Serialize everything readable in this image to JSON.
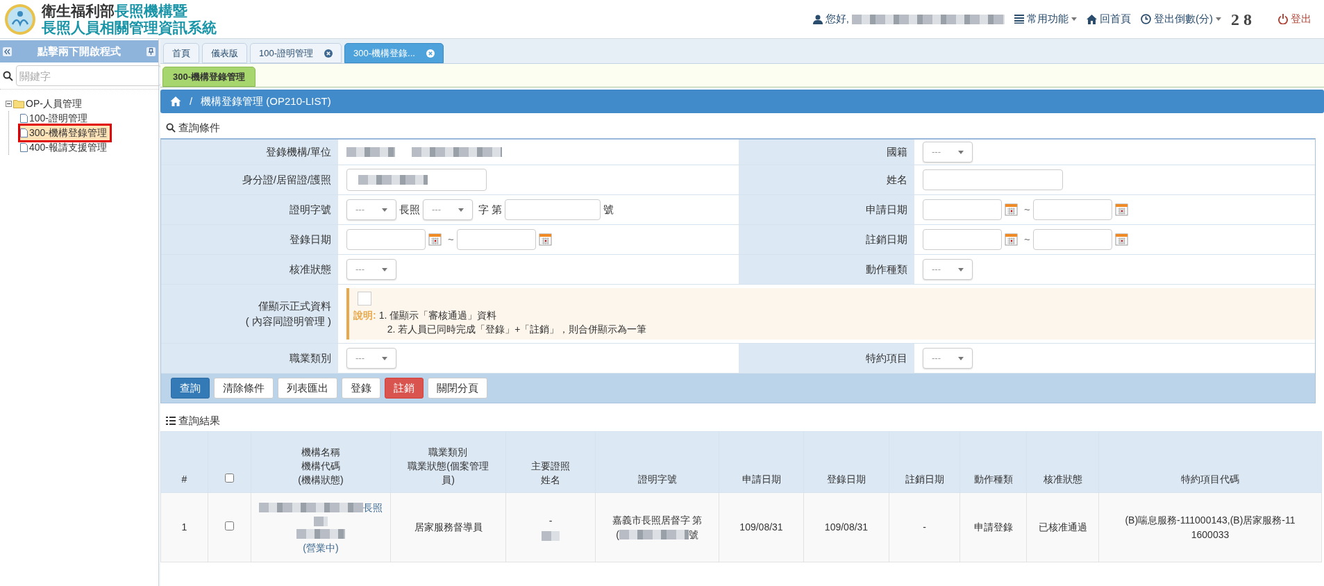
{
  "header": {
    "title_org": "衛生福利部",
    "title_system_line_1": "長照機構暨",
    "title_system_line_2": "長照人員相關管理資訊系統",
    "nav": [
      {
        "kind": "greeting",
        "label": "您好,"
      },
      {
        "kind": "menu",
        "label": "常用功能"
      },
      {
        "kind": "home",
        "label": "回首頁"
      },
      {
        "kind": "timer",
        "label": "登出倒數(分)"
      },
      {
        "kind": "countdown",
        "label": "2 8"
      },
      {
        "kind": "logout",
        "label": "登出"
      }
    ]
  },
  "sidebar": {
    "title": "點擊兩下開啟程式",
    "search": {
      "placeholder": "關鍵字"
    },
    "tree": [
      {
        "label": "OP-人員管理",
        "expanded": true,
        "children": [
          {
            "label": "100-證明管理",
            "selected": false
          },
          {
            "label": "300-機構登錄管理",
            "selected": true
          },
          {
            "label": "400-報請支援管理",
            "selected": false
          }
        ]
      }
    ]
  },
  "tabs": [
    {
      "label": "首頁",
      "selected": false,
      "closable": false
    },
    {
      "label": "儀表版",
      "selected": false,
      "closable": false
    },
    {
      "label": "100-證明管理",
      "selected": false,
      "closable": true
    },
    {
      "label": "300-機構登錄...",
      "selected": true,
      "closable": true
    }
  ],
  "sub_tabs": [
    {
      "label": "300-機構登錄管理",
      "selected": true
    }
  ],
  "breadcrumb": {
    "separator": "/",
    "title": "機構登錄管理 (OP210-LIST)"
  },
  "query": {
    "title": "查詢條件",
    "rows": [
      {
        "kind": "pair",
        "left": {
          "label": "登錄機構/單位",
          "field": {
            "kind": "blurred"
          }
        },
        "right": {
          "label": "國籍",
          "field": {
            "kind": "select",
            "value": "---"
          }
        }
      },
      {
        "kind": "pair",
        "left": {
          "label": "身分證/居留證/護照",
          "field": {
            "kind": "blurred_input"
          }
        },
        "right": {
          "label": "姓名",
          "field": {
            "kind": "input"
          }
        }
      },
      {
        "kind": "pair",
        "left": {
          "label": "證明字號",
          "field": {
            "kind": "cert_no",
            "select_1": "---",
            "text_1": "長照",
            "select_2": "---",
            "text_2": "字 第",
            "text_3": "號"
          }
        },
        "right": {
          "label": "申請日期",
          "field": {
            "kind": "date_range",
            "separator": "~"
          }
        }
      },
      {
        "kind": "pair",
        "left": {
          "label": "登錄日期",
          "field": {
            "kind": "date_range",
            "separator": "~"
          }
        },
        "right": {
          "label": "註銷日期",
          "field": {
            "kind": "date_range",
            "separator": "~"
          }
        }
      },
      {
        "kind": "pair",
        "left": {
          "label": "核准狀態",
          "field": {
            "kind": "select",
            "value": "---"
          }
        },
        "right": {
          "label": "動作種類",
          "field": {
            "kind": "select",
            "value": "---"
          }
        }
      },
      {
        "kind": "notice",
        "label_lines": [
          "僅顯示正式資料",
          "( 內容同證明管理 )"
        ],
        "checked": false,
        "note_label": "說明:",
        "notes": [
          "1. 僅顯示「審核通過」資料",
          "2. 若人員已同時完成「登錄」+「註銷」，則合併顯示為一筆"
        ]
      },
      {
        "kind": "pair",
        "left": {
          "label": "職業類別",
          "field": {
            "kind": "select",
            "value": "---"
          }
        },
        "right": {
          "label": "特約項目",
          "field": {
            "kind": "select",
            "value": "---"
          }
        }
      }
    ],
    "buttons": [
      {
        "label": "查詢",
        "kind": "primary"
      },
      {
        "label": "清除條件",
        "kind": "default"
      },
      {
        "label": "列表匯出",
        "kind": "default"
      },
      {
        "label": "登錄",
        "kind": "default"
      },
      {
        "label": "註銷",
        "kind": "danger"
      },
      {
        "label": "關閉分頁",
        "kind": "default"
      }
    ]
  },
  "results": {
    "title": "查詢結果",
    "columns": [
      {
        "kind": "text",
        "lines": [
          "#"
        ]
      },
      {
        "kind": "checkbox",
        "checked": false
      },
      {
        "kind": "text",
        "lines": [
          "機構名稱",
          "機構代碼",
          "(機構狀態)"
        ]
      },
      {
        "kind": "text",
        "lines": [
          "職業類別",
          "職業狀態(個案管理",
          "員)"
        ]
      },
      {
        "kind": "text",
        "lines": [
          "主要證照",
          "姓名"
        ]
      },
      {
        "kind": "text",
        "lines": [
          "證明字號"
        ]
      },
      {
        "kind": "text",
        "lines": [
          "申請日期"
        ]
      },
      {
        "kind": "text",
        "lines": [
          "登錄日期"
        ]
      },
      {
        "kind": "text",
        "lines": [
          "註銷日期"
        ]
      },
      {
        "kind": "text",
        "lines": [
          "動作種類"
        ]
      },
      {
        "kind": "text",
        "lines": [
          "核准狀態"
        ]
      },
      {
        "kind": "text",
        "lines": [
          "特約項目代碼"
        ]
      }
    ],
    "rows": [
      {
        "index": "1",
        "checked": false,
        "org_license": "長照",
        "org_status": "(營業中)",
        "occupation": "居家服務督導員",
        "license": "-",
        "cert_no_line_1": "嘉義市長照居督字 第",
        "cert_no_open": "(",
        "cert_no_close": "號",
        "apply_date": "109/08/31",
        "register_date": "109/08/31",
        "cancel_date": "-",
        "action": "申請登錄",
        "approval": "已核准通過",
        "special_items": "(B)喘息服務-111000143,(B)居家服務-111600033"
      }
    ]
  }
}
